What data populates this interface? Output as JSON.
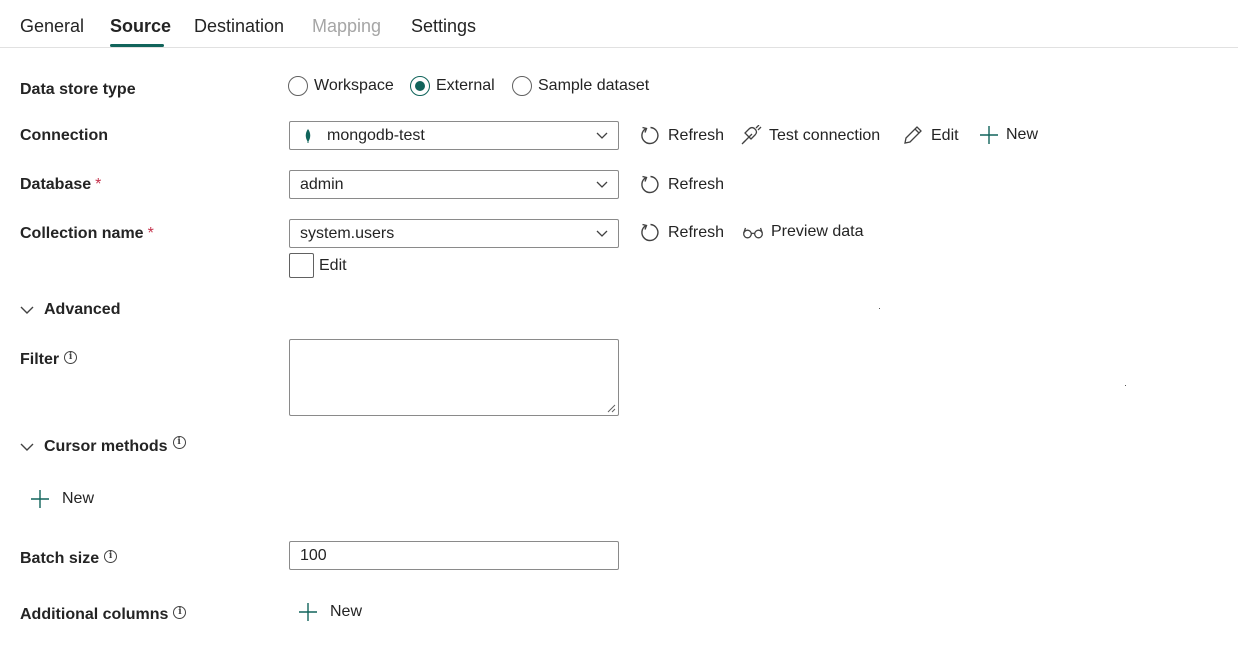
{
  "tabs": [
    {
      "label": "General",
      "state": "normal"
    },
    {
      "label": "Source",
      "state": "active"
    },
    {
      "label": "Destination",
      "state": "normal"
    },
    {
      "label": "Mapping",
      "state": "disabled"
    },
    {
      "label": "Settings",
      "state": "normal"
    }
  ],
  "accent_color": "#11645b",
  "data_store_type": {
    "label": "Data store type",
    "options": [
      "Workspace",
      "External",
      "Sample dataset"
    ],
    "selected": "External"
  },
  "connection": {
    "label": "Connection",
    "value": "mongodb-test",
    "icon": "mongodb-leaf-icon",
    "actions": {
      "refresh": "Refresh",
      "test": "Test connection",
      "edit": "Edit",
      "new": "New"
    }
  },
  "database": {
    "label": "Database",
    "required_mark": "*",
    "value": "admin",
    "actions": {
      "refresh": "Refresh"
    }
  },
  "collection": {
    "label": "Collection name",
    "required_mark": "*",
    "value": "system.users",
    "actions": {
      "refresh": "Refresh",
      "preview": "Preview data"
    },
    "edit_checkbox_label": "Edit",
    "edit_checked": false
  },
  "advanced": {
    "label": "Advanced",
    "expanded": true,
    "filter": {
      "label": "Filter",
      "value": ""
    },
    "cursor_methods": {
      "label": "Cursor methods",
      "new_label": "New"
    },
    "batch_size": {
      "label": "Batch size",
      "value": "100"
    },
    "additional_columns": {
      "label": "Additional columns",
      "new_label": "New"
    }
  }
}
